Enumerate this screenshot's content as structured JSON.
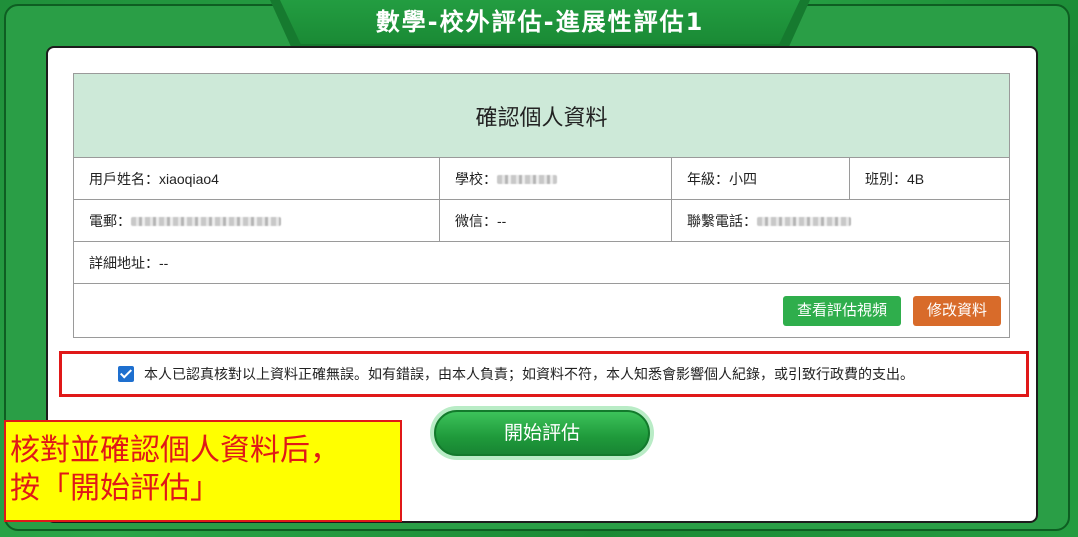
{
  "window": {
    "title": "數學-校外評估-進展性評估1"
  },
  "profile": {
    "heading": "確認個人資料",
    "username": "用戶姓名：xiaoqiao4",
    "school_label": "學校：",
    "grade": "年級：小四",
    "class": "班別：4B",
    "email_label": "電郵：",
    "wechat": "微信：--",
    "phone_label": "聯繫電話：",
    "address": "詳細地址：--"
  },
  "buttons": {
    "view_video": "查看評估視頻",
    "edit_profile": "修改資料",
    "start": "開始評估"
  },
  "confirm": {
    "checked": true,
    "text": "本人已認真核對以上資料正確無誤。如有錯誤，由本人負責；如資料不符，本人知悉會影響個人紀錄，或引致行政費的支出。"
  },
  "note": {
    "line1": "核對並確認個人資料后，",
    "line2": "按「開始評估」"
  },
  "colors": {
    "background_green": "#2a9e46",
    "header_cell": "#cde9d8",
    "btn_green": "#2fae4c",
    "btn_orange": "#d86b2a",
    "highlight_red": "#e01818",
    "note_yellow": "#ffff00"
  },
  "icons": {
    "checkbox": "checkbox-checked-icon"
  }
}
